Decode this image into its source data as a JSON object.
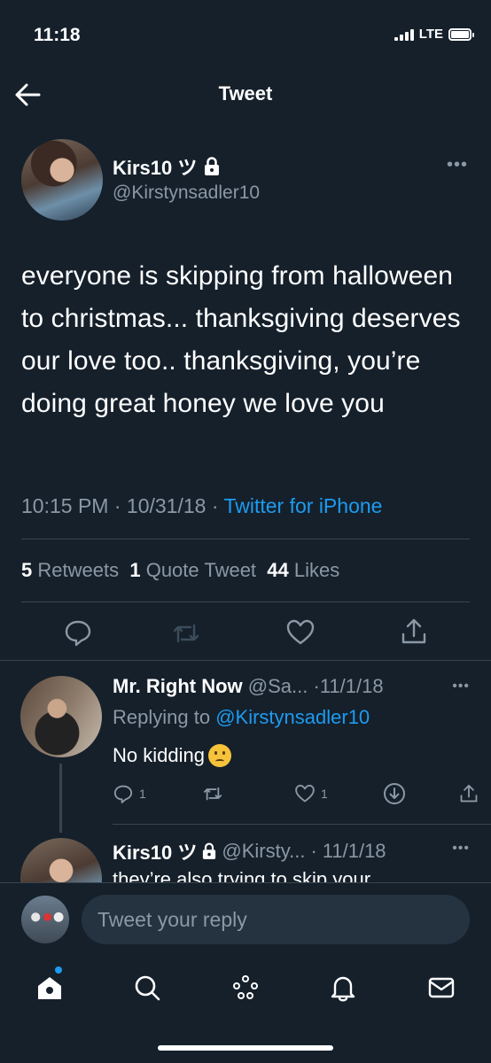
{
  "status_bar": {
    "time": "11:18",
    "network": "LTE"
  },
  "header": {
    "title": "Tweet"
  },
  "tweet": {
    "author_name": "Kirs10 ツ",
    "author_handle": "@Kirstynsadler10",
    "text": "everyone is skipping from halloween to christmas... thanksgiving deserves our love too.. thanksgiving, you’re doing great honey we love you",
    "time": "10:15 PM",
    "date": "10/31/18",
    "source": "Twitter for iPhone",
    "retweets_count": "5",
    "retweets_label": "Retweets",
    "quotes_count": "1",
    "quotes_label": "Quote Tweet",
    "likes_count": "44",
    "likes_label": "Likes"
  },
  "replies": [
    {
      "name": "Mr. Right Now",
      "handle": "@Sa...",
      "date": "11/1/18",
      "replying_prefix": "Replying to",
      "replying_to": "@Kirstynsadler10",
      "text": "No kidding",
      "reply_count": "1",
      "retweet_count": "",
      "like_count": "1"
    },
    {
      "name": "Kirs10 ツ",
      "handle": "@Kirsty...",
      "date": "11/1/18",
      "text": "they’re also trying to skip your"
    }
  ],
  "compose": {
    "placeholder": "Tweet your reply"
  },
  "colors": {
    "background": "#15202b",
    "accent": "#1d9bf0",
    "muted": "#8b98a5",
    "divider": "#38444d"
  },
  "icons": [
    "back-arrow-icon",
    "lock-icon",
    "more-icon",
    "reply-icon",
    "retweet-icon",
    "like-icon",
    "share-icon",
    "download-icon",
    "home-icon",
    "search-icon",
    "spaces-icon",
    "notifications-icon",
    "messages-icon"
  ]
}
